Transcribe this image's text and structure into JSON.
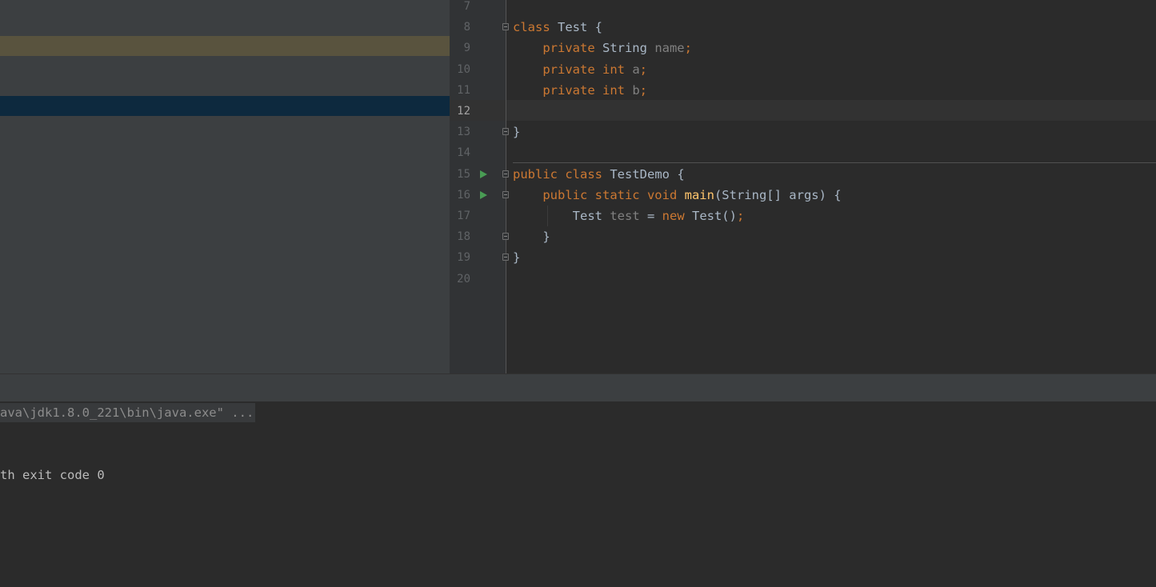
{
  "colors": {
    "keyword": "#cc7832",
    "plain": "#a9b7c6",
    "field": "#9876aa",
    "unused": "#808080",
    "method": "#ffc66d",
    "line_number": "#606366",
    "search_highlight_row": "#59533e",
    "selected_row": "#0d293e",
    "run_icon": "#499c54"
  },
  "project_tree": {
    "rows": [
      {
        "state": "highlighted"
      },
      {
        "state": "selected"
      }
    ]
  },
  "editor": {
    "current_line": "12",
    "lines": [
      {
        "num": "7",
        "tokens": []
      },
      {
        "num": "8",
        "tokens": [
          [
            "kw",
            "class "
          ],
          [
            "pl",
            "Test {"
          ]
        ]
      },
      {
        "num": "9",
        "tokens": [
          [
            "pl",
            "    "
          ],
          [
            "kw",
            "private "
          ],
          [
            "pl",
            "String "
          ],
          [
            "un",
            "name"
          ],
          [
            "kw",
            ";"
          ]
        ]
      },
      {
        "num": "10",
        "tokens": [
          [
            "pl",
            "    "
          ],
          [
            "kw",
            "private int "
          ],
          [
            "un",
            "a"
          ],
          [
            "kw",
            ";"
          ]
        ]
      },
      {
        "num": "11",
        "tokens": [
          [
            "pl",
            "    "
          ],
          [
            "kw",
            "private int "
          ],
          [
            "un",
            "b"
          ],
          [
            "kw",
            ";"
          ]
        ]
      },
      {
        "num": "12",
        "tokens": []
      },
      {
        "num": "13",
        "tokens": [
          [
            "pl",
            "}"
          ]
        ]
      },
      {
        "num": "14",
        "tokens": []
      },
      {
        "num": "15",
        "tokens": [
          [
            "kw",
            "public class "
          ],
          [
            "pl",
            "TestDemo {"
          ]
        ]
      },
      {
        "num": "16",
        "tokens": [
          [
            "pl",
            "    "
          ],
          [
            "kw",
            "public static void "
          ],
          [
            "me",
            "main"
          ],
          [
            "pl",
            "(String[] args) {"
          ]
        ]
      },
      {
        "num": "17",
        "tokens": [
          [
            "pl",
            "        Test "
          ],
          [
            "un",
            "test"
          ],
          [
            "pl",
            " = "
          ],
          [
            "kw",
            "new "
          ],
          [
            "pl",
            "Test()"
          ],
          [
            "kw",
            ";"
          ]
        ]
      },
      {
        "num": "18",
        "tokens": [
          [
            "pl",
            "    }"
          ]
        ]
      },
      {
        "num": "19",
        "tokens": [
          [
            "pl",
            "}"
          ]
        ]
      },
      {
        "num": "20",
        "tokens": []
      }
    ]
  },
  "console": {
    "command_text": "ava\\jdk1.8.0_221\\bin\\java.exe\" ...",
    "exit_text": "th exit code 0"
  }
}
